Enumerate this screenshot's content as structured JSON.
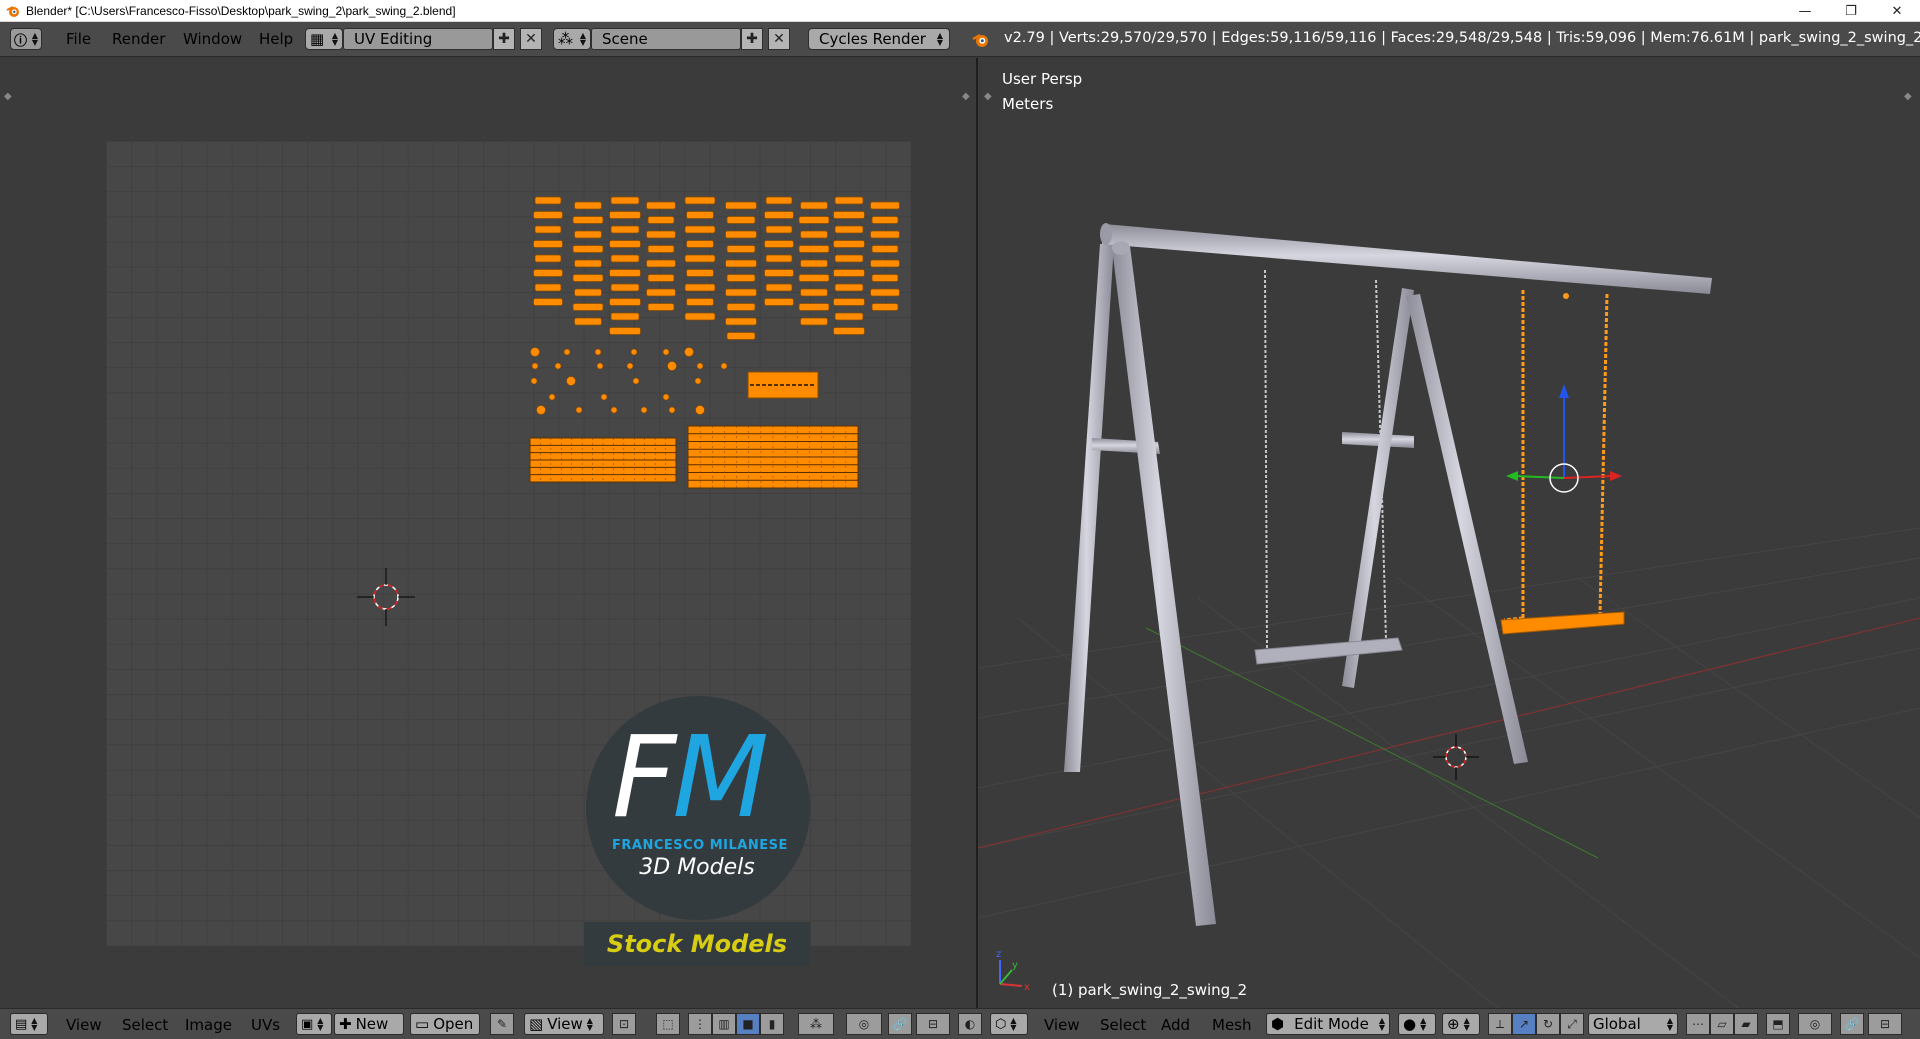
{
  "window": {
    "title": "Blender* [C:\\Users\\Francesco-Fisso\\Desktop\\park_swing_2\\park_swing_2.blend]",
    "minimize_glyph": "—",
    "restore_glyph": "❐",
    "close_glyph": "✕"
  },
  "info_header": {
    "menus": [
      "File",
      "Render",
      "Window",
      "Help"
    ],
    "screen_layout": "UV Editing",
    "scene": "Scene",
    "render_engine": "Cycles Render",
    "stats": "v2.79 | Verts:29,570/29,570 | Edges:59,116/59,116 | Faces:29,548/29,548 | Tris:59,096 | Mem:76.61M | park_swing_2_swing_2"
  },
  "uv_editor": {
    "menus": [
      "View",
      "Select",
      "Image",
      "UVs"
    ],
    "new_label": "New",
    "open_label": "Open",
    "view_label": "View"
  },
  "viewport": {
    "view_name": "User Persp",
    "units": "Meters",
    "object_label": "(1) park_swing_2_swing_2",
    "menus": [
      "View",
      "Select",
      "Add",
      "Mesh"
    ],
    "mode": "Edit Mode",
    "orientation": "Global"
  },
  "watermark": {
    "letter_f": "F",
    "letter_m": "M",
    "name": "FRANCESCO MILANESE",
    "tagline": "3D Models",
    "band": "Stock Models"
  },
  "colors": {
    "uv_selected": "#ff8c00",
    "swing_metal": "#b0b0bc",
    "watermark_blue": "#1fa6e0",
    "watermark_yellow": "#d8cd12"
  }
}
